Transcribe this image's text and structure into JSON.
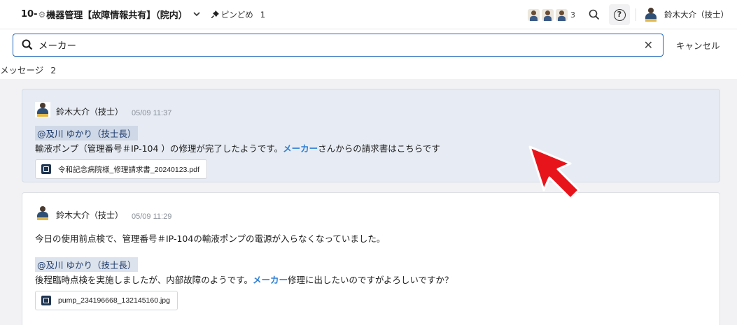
{
  "header": {
    "channel_prefix": "10-",
    "channel_name": "機器管理【故障情報共有】（院内）",
    "pin_label": "ピンどめ",
    "pin_count": "1",
    "member_count": "3",
    "current_user": "鈴木大介（技士）",
    "icons": [
      "gear-icon",
      "chevron-down-icon",
      "pin-icon",
      "search-icon",
      "help-icon"
    ]
  },
  "search": {
    "value": "メーカー",
    "clear_label": "✕",
    "cancel_label": "キャンセル"
  },
  "results": {
    "label": "メッセージ",
    "count": "2"
  },
  "messages": [
    {
      "author": "鈴木大介（技士）",
      "time": "05/09 11:37",
      "mention": "@及川 ゆかり（技士長）",
      "text_before": "輸液ポンプ（管理番号＃IP-104 ）の修理が完了したようです。",
      "highlight": "メーカー",
      "text_after": "さんからの請求書はこちらです",
      "attachment": "令和記念病院様_修理請求書_20240123.pdf"
    },
    {
      "author": "鈴木大介（技士）",
      "time": "05/09 11:29",
      "line1": "今日の使用前点検で、管理番号＃IP-104の輸液ポンプの電源が入らなくなっていました。",
      "mention": "@及川 ゆかり（技士長）",
      "text_before": "後程臨時点検を実施しましたが、内部故障のようです。",
      "highlight": "メーカー",
      "text_after": "修理に出したいのですがよろしいですか？",
      "attachment": "pump_234196668_132145160.jpg"
    }
  ],
  "colors": {
    "accent": "#1d66b8",
    "highlight_text": "#2f7fd4",
    "active_card": "#e7ecf4",
    "pointer_arrow": "#e8141c"
  }
}
